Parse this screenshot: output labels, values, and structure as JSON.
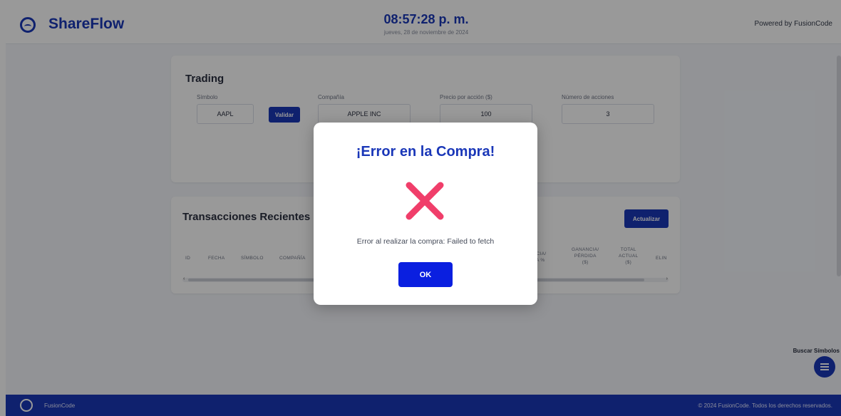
{
  "header": {
    "brand": "ShareFlow",
    "clock": "08:57:28 p. m.",
    "date": "jueves, 28 de noviembre de 2024",
    "powered_by": "Powered by FusionCode"
  },
  "trading": {
    "title": "Trading",
    "symbol_label": "Símbolo",
    "symbol_value": "AAPL",
    "validate_label": "Validar",
    "company_label": "Compañía",
    "company_value": "APPLE INC",
    "price_label": "Precio por acción ($)",
    "price_value": "100",
    "shares_label": "Número de acciones",
    "shares_value": "3"
  },
  "transactions": {
    "title": "Transacciones Recientes",
    "refresh_label": "Actualizar",
    "headers_left": [
      "ID",
      "FECHA",
      "SÍMBOLO",
      "COMPAÑÍA"
    ],
    "headers_right": [
      "NANCIA/\nDIDA %",
      "GANANCIA/\nPÉRDIDA\n($)",
      "TOTAL\nACTUAL\n($)",
      "ELIN"
    ]
  },
  "sidebar": {
    "search_symbols_label": "Buscar Símbolos"
  },
  "footer": {
    "brand": "FusionCode",
    "copyright": "© 2024 FusionCode. Todos los derechos reservados."
  },
  "modal": {
    "title": "¡Error en la Compra!",
    "message": "Error al realizar la compra: Failed to fetch",
    "ok_label": "OK"
  },
  "colors": {
    "brand_blue": "#1a37b8",
    "error_red": "#f03e6a",
    "ok_blue": "#0a1fe0"
  }
}
